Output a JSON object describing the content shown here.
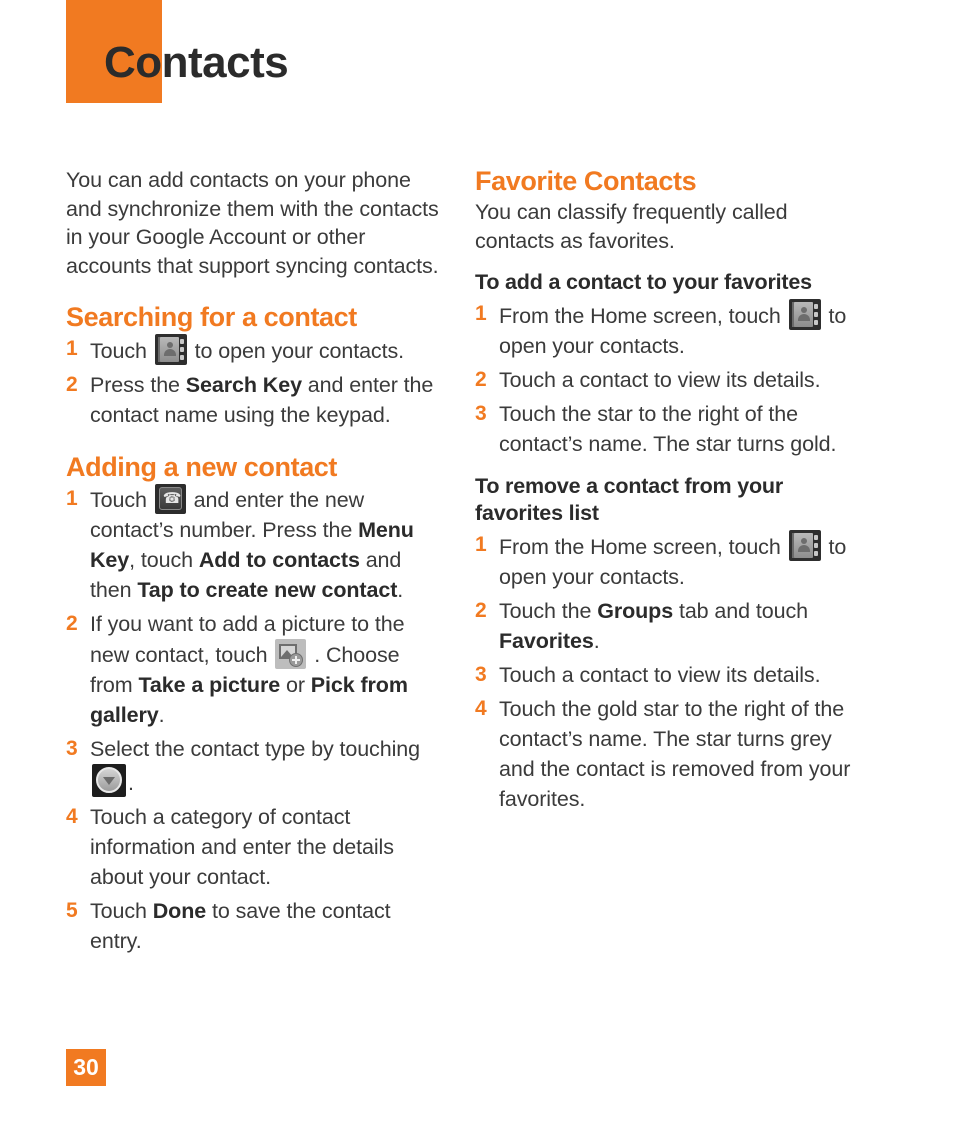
{
  "header": {
    "title": "Contacts",
    "accent_color": "#f17a21"
  },
  "footer": {
    "page_number": "30"
  },
  "left_column": {
    "intro": "You can add contacts on your phone and synchronize them with the contacts in your Google Account or other accounts that support syncing contacts.",
    "sections": [
      {
        "heading": "Searching for a contact",
        "steps": [
          {
            "num": "1",
            "parts": [
              {
                "type": "text",
                "text": "Touch "
              },
              {
                "type": "icon",
                "icon": "contacts-book-icon"
              },
              {
                "type": "text",
                "text": " to open your contacts."
              }
            ]
          },
          {
            "num": "2",
            "parts": [
              {
                "type": "text",
                "text": "Press the "
              },
              {
                "type": "bold",
                "text": "Search Key"
              },
              {
                "type": "text",
                "text": " and enter the contact name using the keypad."
              }
            ]
          }
        ]
      },
      {
        "heading": "Adding a new contact",
        "steps": [
          {
            "num": "1",
            "parts": [
              {
                "type": "text",
                "text": "Touch "
              },
              {
                "type": "icon",
                "icon": "phone-dial-icon"
              },
              {
                "type": "text",
                "text": " and enter the new contact’s number. Press the "
              },
              {
                "type": "bold",
                "text": "Menu Key"
              },
              {
                "type": "text",
                "text": ", touch "
              },
              {
                "type": "bold",
                "text": "Add to contacts"
              },
              {
                "type": "text",
                "text": " and then "
              },
              {
                "type": "bold",
                "text": "Tap to create new contact"
              },
              {
                "type": "text",
                "text": "."
              }
            ]
          },
          {
            "num": "2",
            "parts": [
              {
                "type": "text",
                "text": "If you want to add a picture to the new contact, touch "
              },
              {
                "type": "icon",
                "icon": "add-picture-icon"
              },
              {
                "type": "text",
                "text": " . Choose from "
              },
              {
                "type": "bold",
                "text": "Take a picture"
              },
              {
                "type": "text",
                "text": " or "
              },
              {
                "type": "bold",
                "text": "Pick from gallery"
              },
              {
                "type": "text",
                "text": "."
              }
            ]
          },
          {
            "num": "3",
            "parts": [
              {
                "type": "text",
                "text": "Select the contact type by touching "
              },
              {
                "type": "icon",
                "icon": "dropdown-circle-icon"
              },
              {
                "type": "text",
                "text": "."
              }
            ]
          },
          {
            "num": "4",
            "parts": [
              {
                "type": "text",
                "text": "Touch a category of contact information and enter the details about your contact."
              }
            ]
          },
          {
            "num": "5",
            "parts": [
              {
                "type": "text",
                "text": "Touch "
              },
              {
                "type": "bold",
                "text": "Done"
              },
              {
                "type": "text",
                "text": " to save the contact entry."
              }
            ]
          }
        ]
      }
    ]
  },
  "right_column": {
    "sections": [
      {
        "heading": "Favorite Contacts",
        "intro": "You can classify frequently called contacts as favorites.",
        "subsections": [
          {
            "sub_heading": "To add a contact to your favorites",
            "steps": [
              {
                "num": "1",
                "parts": [
                  {
                    "type": "text",
                    "text": "From the Home screen, touch "
                  },
                  {
                    "type": "icon",
                    "icon": "contacts-book-icon"
                  },
                  {
                    "type": "text",
                    "text": " to open your contacts."
                  }
                ]
              },
              {
                "num": "2",
                "parts": [
                  {
                    "type": "text",
                    "text": "Touch a contact to view its details."
                  }
                ]
              },
              {
                "num": "3",
                "parts": [
                  {
                    "type": "text",
                    "text": "Touch the star to the right of the contact’s name. The star turns gold."
                  }
                ]
              }
            ]
          },
          {
            "sub_heading": "To remove a contact from your favorites list",
            "steps": [
              {
                "num": "1",
                "parts": [
                  {
                    "type": "text",
                    "text": "From the Home screen, touch "
                  },
                  {
                    "type": "icon",
                    "icon": "contacts-book-icon"
                  },
                  {
                    "type": "text",
                    "text": " to open your contacts."
                  }
                ]
              },
              {
                "num": "2",
                "parts": [
                  {
                    "type": "text",
                    "text": "Touch the "
                  },
                  {
                    "type": "bold",
                    "text": "Groups"
                  },
                  {
                    "type": "text",
                    "text": " tab and touch "
                  },
                  {
                    "type": "bold",
                    "text": "Favorites"
                  },
                  {
                    "type": "text",
                    "text": "."
                  }
                ]
              },
              {
                "num": "3",
                "parts": [
                  {
                    "type": "text",
                    "text": "Touch a contact to view its details."
                  }
                ]
              },
              {
                "num": "4",
                "parts": [
                  {
                    "type": "text",
                    "text": "Touch the gold star to the right of the contact’s name. The star turns grey and the contact is removed from your favorites."
                  }
                ]
              }
            ]
          }
        ]
      }
    ]
  }
}
